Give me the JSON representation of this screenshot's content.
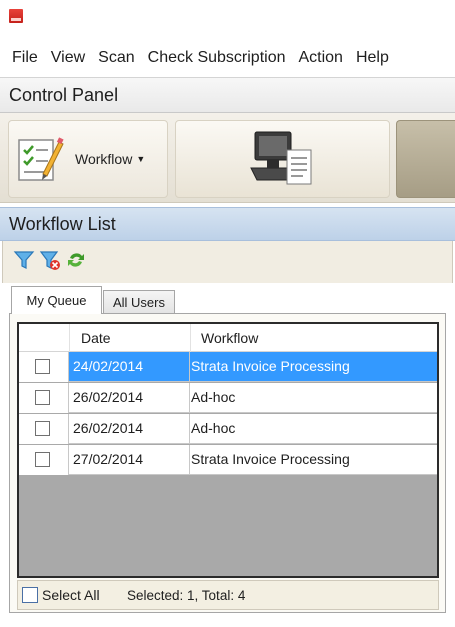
{
  "menu": [
    "File",
    "View",
    "Scan",
    "Check Subscription",
    "Action",
    "Help"
  ],
  "control_panel": {
    "title": "Control Panel",
    "workflow_button": "Workflow"
  },
  "workflow_list": {
    "title": "Workflow List",
    "toolbar_icons": [
      "filter-icon",
      "clear-filter-icon",
      "refresh-icon"
    ],
    "tabs": [
      "My Queue",
      "All Users"
    ],
    "columns": [
      "Date",
      "Workflow"
    ],
    "rows": [
      {
        "date": "24/02/2014",
        "workflow": "Strata Invoice Processing",
        "selected": true
      },
      {
        "date": "26/02/2014",
        "workflow": "Ad-hoc",
        "selected": false
      },
      {
        "date": "26/02/2014",
        "workflow": "Ad-hoc",
        "selected": false
      },
      {
        "date": "27/02/2014",
        "workflow": "Strata Invoice Processing",
        "selected": false
      }
    ],
    "select_all": "Select All",
    "status": "Selected: 1, Total: 4"
  },
  "colors": {
    "selection": "#3399ff",
    "header_blue": "#bdd1e8",
    "ribbon": "#e4dfd3"
  }
}
